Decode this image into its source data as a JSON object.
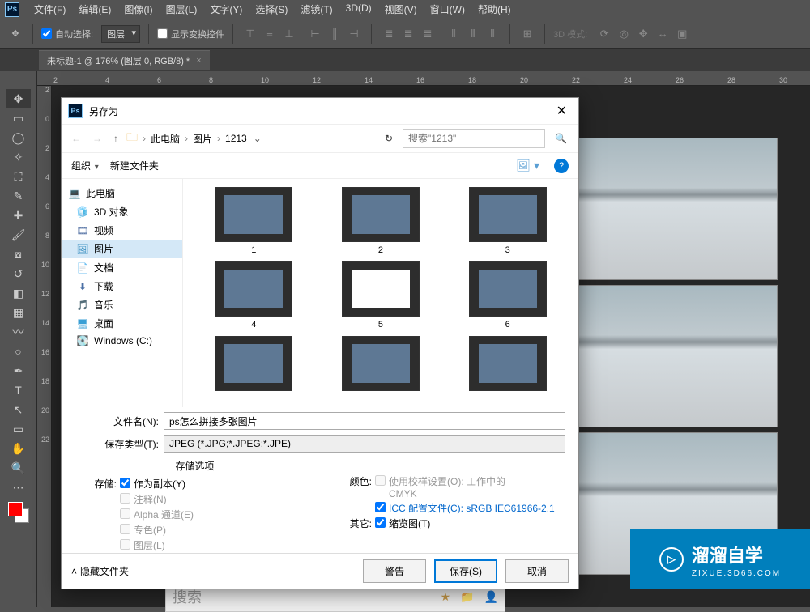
{
  "menubar": {
    "items": [
      "文件(F)",
      "编辑(E)",
      "图像(I)",
      "图层(L)",
      "文字(Y)",
      "选择(S)",
      "滤镜(T)",
      "3D(D)",
      "视图(V)",
      "窗口(W)",
      "帮助(H)"
    ]
  },
  "optionsbar": {
    "auto_select": "自动选择:",
    "layer_dd": "图层",
    "show_transform": "显示变换控件",
    "mode_label": "3D 模式:"
  },
  "doctab": {
    "title": "未标题-1 @ 176% (图层 0, RGB/8) *"
  },
  "ruler_h": [
    "2",
    "4",
    "6",
    "8",
    "10",
    "12",
    "14",
    "16",
    "18",
    "20",
    "22",
    "24",
    "26",
    "28",
    "30"
  ],
  "ruler_v": [
    "2",
    "0",
    "2",
    "4",
    "6",
    "8",
    "10",
    "12",
    "14",
    "16",
    "18",
    "20",
    "22"
  ],
  "toolbar": {
    "tools": [
      "move",
      "marquee",
      "lasso",
      "wand",
      "crop",
      "eyedrop",
      "patch",
      "brush",
      "stamp",
      "history",
      "eraser",
      "gradient",
      "smudge",
      "dodge",
      "pen",
      "type",
      "arrow",
      "shape-rect",
      "hand",
      "zoom",
      "more"
    ]
  },
  "dialog": {
    "title": "另存为",
    "breadcrumb": [
      "此电脑",
      "图片",
      "1213"
    ],
    "search_placeholder": "搜索\"1213\"",
    "organize": "组织",
    "new_folder": "新建文件夹",
    "tree": [
      {
        "label": "此电脑",
        "icon": "pc",
        "root": true
      },
      {
        "label": "3D 对象",
        "icon": "3d"
      },
      {
        "label": "视频",
        "icon": "vid"
      },
      {
        "label": "图片",
        "icon": "pic",
        "selected": true
      },
      {
        "label": "文档",
        "icon": "doc"
      },
      {
        "label": "下载",
        "icon": "dl"
      },
      {
        "label": "音乐",
        "icon": "mus"
      },
      {
        "label": "桌面",
        "icon": "desk"
      },
      {
        "label": "Windows (C:)",
        "icon": "drv"
      }
    ],
    "files": [
      {
        "name": "1",
        "style": "blue"
      },
      {
        "name": "2",
        "style": "blue"
      },
      {
        "name": "3",
        "style": "blue"
      },
      {
        "name": "4",
        "style": "blue"
      },
      {
        "name": "5",
        "style": "white"
      },
      {
        "name": "6",
        "style": "blue"
      },
      {
        "name": "",
        "style": "blue"
      },
      {
        "name": "",
        "style": "blue"
      },
      {
        "name": "",
        "style": "blue"
      }
    ],
    "filename_label": "文件名(N):",
    "filename_value": "ps怎么拼接多张图片",
    "type_label": "保存类型(T):",
    "type_value": "JPEG (*.JPG;*.JPEG;*.JPE)",
    "opts_title": "存储选项",
    "store_label": "存储:",
    "opt_copy": "作为副本(Y)",
    "opt_notes": "注释(N)",
    "opt_alpha": "Alpha 通道(E)",
    "opt_spot": "专色(P)",
    "opt_layers": "图层(L)",
    "color_label": "颜色:",
    "opt_proof": "使用校样设置(O):  工作中的 CMYK",
    "opt_icc": "ICC 配置文件(C): sRGB IEC61966-2.1",
    "other_label": "其它:",
    "opt_thumb": "缩览图(T)",
    "hide_folders": "隐藏文件夹",
    "btn_warn": "警告",
    "btn_save": "保存(S)",
    "btn_cancel": "取消"
  },
  "searchstrip": {
    "placeholder": "搜索"
  },
  "watermark": {
    "brand": "溜溜自学",
    "url": "ZIXUE.3D66.COM"
  }
}
